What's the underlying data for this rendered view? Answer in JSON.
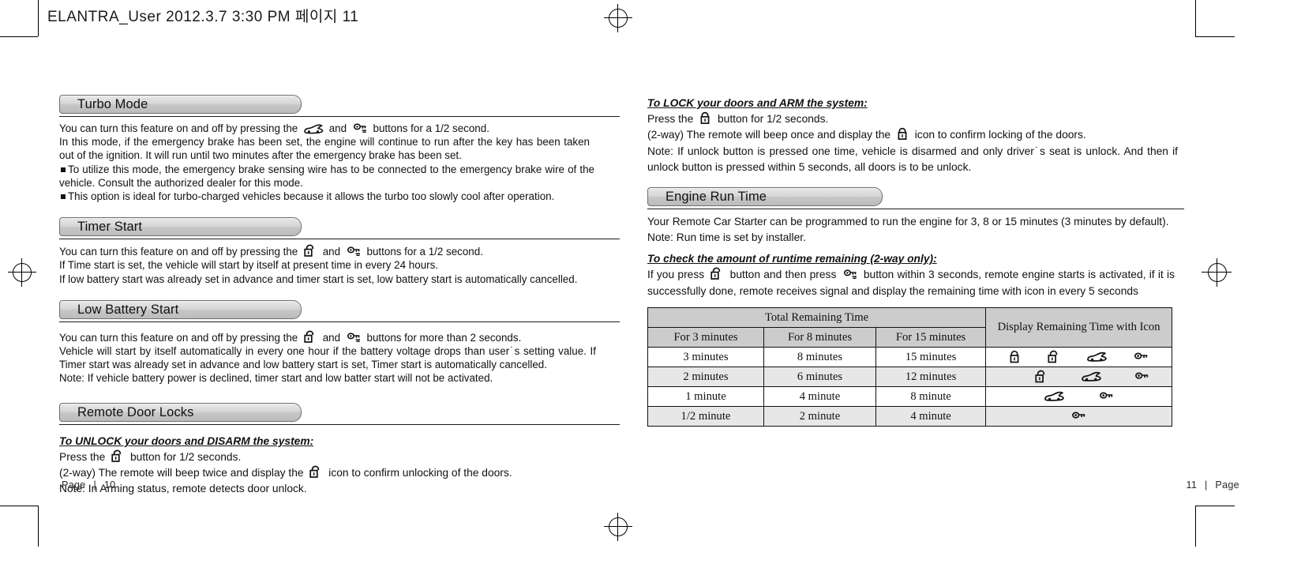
{
  "print_header": "ELANTRA_User  2012.3.7 3:30 PM  페이지 11",
  "footer": {
    "left_label": "Page",
    "left_sep": "|",
    "left_number": "10",
    "right_number": "11",
    "right_sep": "|",
    "right_label": "Page"
  },
  "icons": {
    "lock": "lock-icon",
    "unlock": "unlock-icon",
    "car": "car-icon",
    "key": "key-icon"
  },
  "left_column": {
    "sections": [
      {
        "title": "Turbo Mode",
        "lines": [
          "You can turn this feature on and off by pressing the",
          "and",
          "buttons for a 1/2 second.",
          "In this mode, if the emergency brake has been set, the engine will continue to run after the key has been taken out of the ignition. It will run until two minutes after the emergency brake has been set.",
          "To utilize this mode, the emergency brake sensing wire has to be connected to the emergency brake wire of the vehicle. Consult the authorized dealer for this mode.",
          "This option is ideal for turbo-charged vehicles because it allows the turbo too slowly cool after operation."
        ]
      },
      {
        "title": "Timer Start",
        "lines": [
          "You can turn this feature on and off by pressing the",
          "and",
          "buttons for a 1/2 second.",
          "If Time start is set, the vehicle will start by itself at present time in every 24 hours.",
          "If low battery start was already set in advance and timer start is set, low battery start is automatically cancelled."
        ]
      },
      {
        "title": "Low Battery Start",
        "lines": [
          "You can turn this feature on and off by pressing the",
          "and",
          "buttons for more than 2 seconds.",
          "Vehicle will start by itself automatically in every one hour if the battery voltage drops than user˙s setting value. If Timer start was already set in advance and low battery start is set, Timer start is automatically cancelled.",
          "Note: If vehicle battery power is declined, timer start and low batter start will not be activated."
        ]
      },
      {
        "title": "Remote Door Locks",
        "subtitle": "To UNLOCK your doors and DISARM the system:",
        "lines": [
          "Press the",
          "button for 1/2 seconds.",
          "(2-way) The remote will beep twice and display the",
          "icon to confirm unlocking of the doors.",
          "Note: In Arming status, remote detects door unlock."
        ]
      }
    ]
  },
  "right_column": {
    "lock_block": {
      "subtitle": "To LOCK your doors and ARM the system:",
      "lines": [
        "Press the",
        "button for 1/2 seconds.",
        "(2-way) The remote will beep once and display the",
        "icon to confirm locking of the doors.",
        "Note: If unlock button is pressed one time, vehicle is disarmed and only driver˙s seat is unlock. And then if unlock button is pressed within 5 seconds, all doors is to be unlock."
      ]
    },
    "engine_run_time": {
      "title": "Engine Run Time",
      "lines": [
        "Your Remote Car Starter can be programmed to run the engine for 3, 8 or 15 minutes (3 minutes by default).",
        "Note: Run time is set by installer."
      ],
      "subtitle": "To check the amount of runtime remaining (2-way only):",
      "runtime_lines": [
        "If you press",
        "button and then press",
        "button within 3 seconds, remote engine starts is activated, if it is successfully done, remote receives signal and display the remaining time with icon in every 5 seconds"
      ]
    }
  },
  "table": {
    "group_header": "Total Remaining Time",
    "icon_header": "Display Remaining Time with Icon",
    "columns": [
      "For 3 minutes",
      "For 8 minutes",
      "For 15 minutes"
    ],
    "rows": [
      {
        "values": [
          "3 minutes",
          "8 minutes",
          "15 minutes"
        ],
        "icons": [
          "lock-icon",
          "unlock-icon",
          "car-icon",
          "key-icon"
        ]
      },
      {
        "values": [
          "2 minutes",
          "6 minutes",
          "12 minutes"
        ],
        "icons": [
          "unlock-icon",
          "car-icon",
          "key-icon"
        ]
      },
      {
        "values": [
          "1 minute",
          "4 minute",
          "8 minute"
        ],
        "icons": [
          "car-icon",
          "key-icon"
        ]
      },
      {
        "values": [
          "1/2 minute",
          "2 minute",
          "4 minute"
        ],
        "icons": [
          "key-icon"
        ]
      }
    ]
  }
}
